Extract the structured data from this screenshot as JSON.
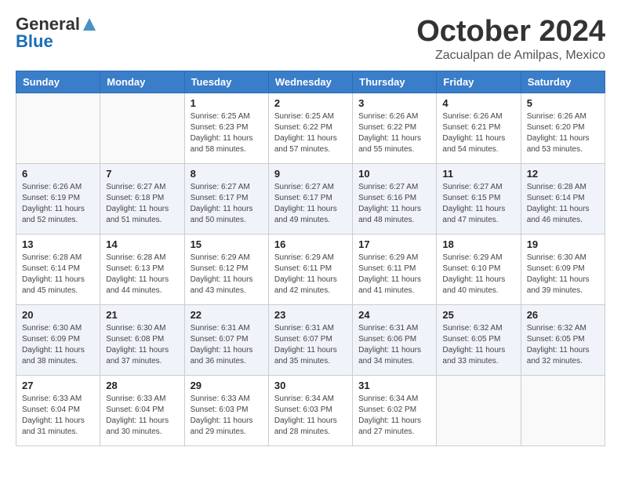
{
  "logo": {
    "general": "General",
    "blue": "Blue"
  },
  "title": "October 2024",
  "location": "Zacualpan de Amilpas, Mexico",
  "days_of_week": [
    "Sunday",
    "Monday",
    "Tuesday",
    "Wednesday",
    "Thursday",
    "Friday",
    "Saturday"
  ],
  "weeks": [
    [
      {
        "day": "",
        "info": ""
      },
      {
        "day": "",
        "info": ""
      },
      {
        "day": "1",
        "info": "Sunrise: 6:25 AM\nSunset: 6:23 PM\nDaylight: 11 hours and 58 minutes."
      },
      {
        "day": "2",
        "info": "Sunrise: 6:25 AM\nSunset: 6:22 PM\nDaylight: 11 hours and 57 minutes."
      },
      {
        "day": "3",
        "info": "Sunrise: 6:26 AM\nSunset: 6:22 PM\nDaylight: 11 hours and 55 minutes."
      },
      {
        "day": "4",
        "info": "Sunrise: 6:26 AM\nSunset: 6:21 PM\nDaylight: 11 hours and 54 minutes."
      },
      {
        "day": "5",
        "info": "Sunrise: 6:26 AM\nSunset: 6:20 PM\nDaylight: 11 hours and 53 minutes."
      }
    ],
    [
      {
        "day": "6",
        "info": "Sunrise: 6:26 AM\nSunset: 6:19 PM\nDaylight: 11 hours and 52 minutes."
      },
      {
        "day": "7",
        "info": "Sunrise: 6:27 AM\nSunset: 6:18 PM\nDaylight: 11 hours and 51 minutes."
      },
      {
        "day": "8",
        "info": "Sunrise: 6:27 AM\nSunset: 6:17 PM\nDaylight: 11 hours and 50 minutes."
      },
      {
        "day": "9",
        "info": "Sunrise: 6:27 AM\nSunset: 6:17 PM\nDaylight: 11 hours and 49 minutes."
      },
      {
        "day": "10",
        "info": "Sunrise: 6:27 AM\nSunset: 6:16 PM\nDaylight: 11 hours and 48 minutes."
      },
      {
        "day": "11",
        "info": "Sunrise: 6:27 AM\nSunset: 6:15 PM\nDaylight: 11 hours and 47 minutes."
      },
      {
        "day": "12",
        "info": "Sunrise: 6:28 AM\nSunset: 6:14 PM\nDaylight: 11 hours and 46 minutes."
      }
    ],
    [
      {
        "day": "13",
        "info": "Sunrise: 6:28 AM\nSunset: 6:14 PM\nDaylight: 11 hours and 45 minutes."
      },
      {
        "day": "14",
        "info": "Sunrise: 6:28 AM\nSunset: 6:13 PM\nDaylight: 11 hours and 44 minutes."
      },
      {
        "day": "15",
        "info": "Sunrise: 6:29 AM\nSunset: 6:12 PM\nDaylight: 11 hours and 43 minutes."
      },
      {
        "day": "16",
        "info": "Sunrise: 6:29 AM\nSunset: 6:11 PM\nDaylight: 11 hours and 42 minutes."
      },
      {
        "day": "17",
        "info": "Sunrise: 6:29 AM\nSunset: 6:11 PM\nDaylight: 11 hours and 41 minutes."
      },
      {
        "day": "18",
        "info": "Sunrise: 6:29 AM\nSunset: 6:10 PM\nDaylight: 11 hours and 40 minutes."
      },
      {
        "day": "19",
        "info": "Sunrise: 6:30 AM\nSunset: 6:09 PM\nDaylight: 11 hours and 39 minutes."
      }
    ],
    [
      {
        "day": "20",
        "info": "Sunrise: 6:30 AM\nSunset: 6:09 PM\nDaylight: 11 hours and 38 minutes."
      },
      {
        "day": "21",
        "info": "Sunrise: 6:30 AM\nSunset: 6:08 PM\nDaylight: 11 hours and 37 minutes."
      },
      {
        "day": "22",
        "info": "Sunrise: 6:31 AM\nSunset: 6:07 PM\nDaylight: 11 hours and 36 minutes."
      },
      {
        "day": "23",
        "info": "Sunrise: 6:31 AM\nSunset: 6:07 PM\nDaylight: 11 hours and 35 minutes."
      },
      {
        "day": "24",
        "info": "Sunrise: 6:31 AM\nSunset: 6:06 PM\nDaylight: 11 hours and 34 minutes."
      },
      {
        "day": "25",
        "info": "Sunrise: 6:32 AM\nSunset: 6:05 PM\nDaylight: 11 hours and 33 minutes."
      },
      {
        "day": "26",
        "info": "Sunrise: 6:32 AM\nSunset: 6:05 PM\nDaylight: 11 hours and 32 minutes."
      }
    ],
    [
      {
        "day": "27",
        "info": "Sunrise: 6:33 AM\nSunset: 6:04 PM\nDaylight: 11 hours and 31 minutes."
      },
      {
        "day": "28",
        "info": "Sunrise: 6:33 AM\nSunset: 6:04 PM\nDaylight: 11 hours and 30 minutes."
      },
      {
        "day": "29",
        "info": "Sunrise: 6:33 AM\nSunset: 6:03 PM\nDaylight: 11 hours and 29 minutes."
      },
      {
        "day": "30",
        "info": "Sunrise: 6:34 AM\nSunset: 6:03 PM\nDaylight: 11 hours and 28 minutes."
      },
      {
        "day": "31",
        "info": "Sunrise: 6:34 AM\nSunset: 6:02 PM\nDaylight: 11 hours and 27 minutes."
      },
      {
        "day": "",
        "info": ""
      },
      {
        "day": "",
        "info": ""
      }
    ]
  ]
}
